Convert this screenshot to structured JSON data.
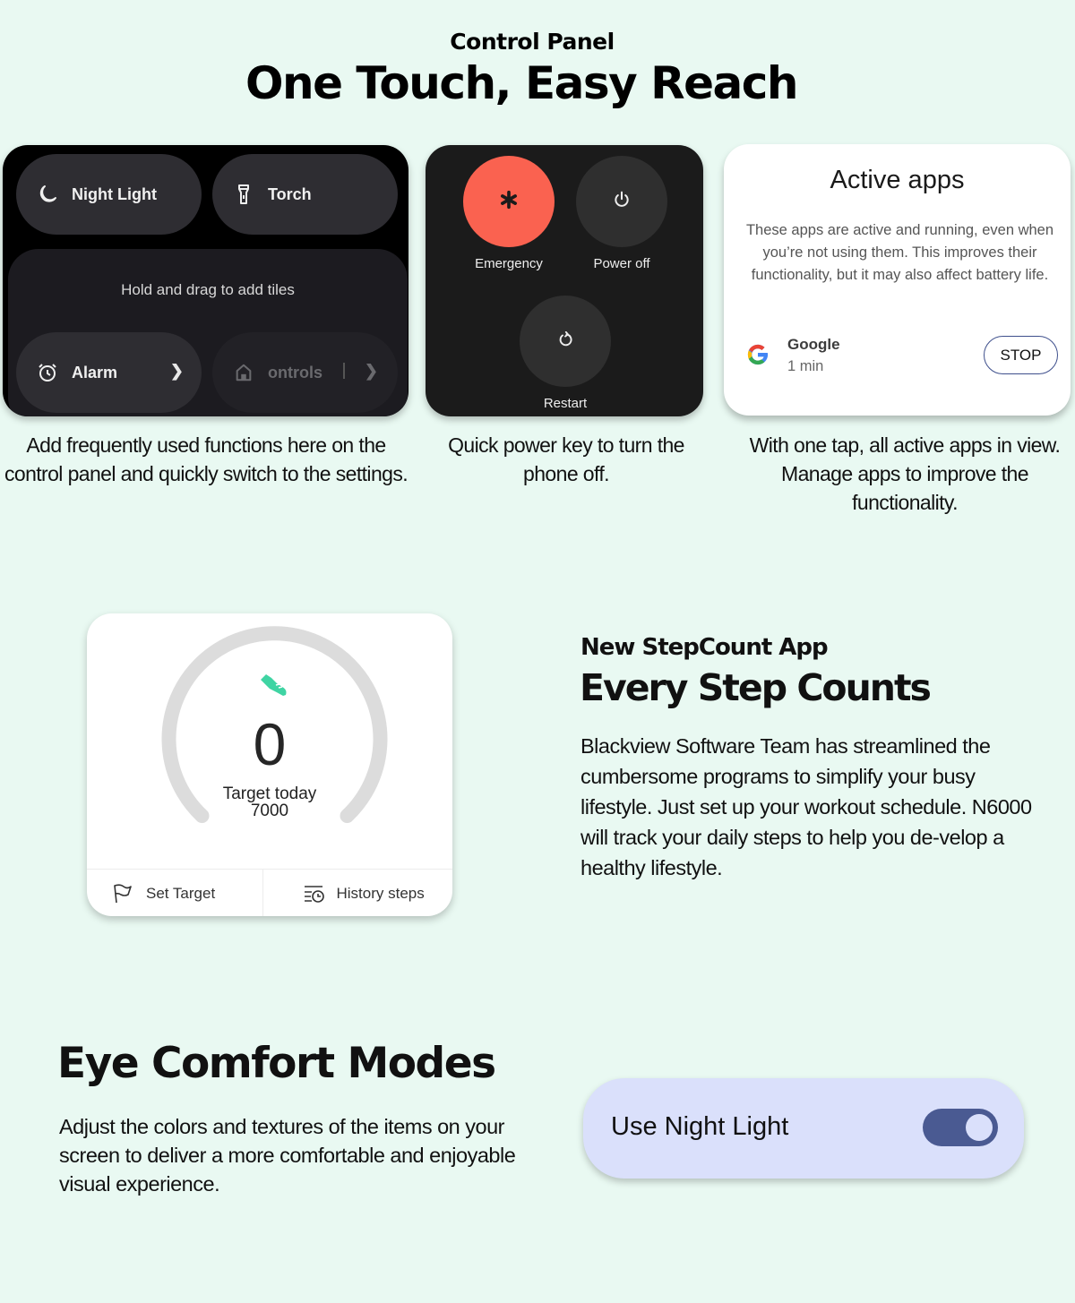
{
  "header": {
    "eyebrow": "Control Panel",
    "title": "One Touch, Easy Reach"
  },
  "quick_tiles": {
    "tiles": [
      {
        "label": "Night Light",
        "icon": "moon-icon"
      },
      {
        "label": "Torch",
        "icon": "flashlight-icon"
      },
      {
        "label": "Alarm",
        "icon": "alarm-clock-icon"
      },
      {
        "label": "ontrols",
        "icon": "home-icon"
      }
    ],
    "drop_hint": "Hold and drag to add tiles",
    "caption": "Add frequently used functions here on the control panel and quickly switch to the settings."
  },
  "power_menu": {
    "buttons": [
      {
        "label": "Emergency",
        "icon": "asterisk-icon",
        "color": "#fa6250"
      },
      {
        "label": "Power off",
        "icon": "power-icon"
      },
      {
        "label": "Restart",
        "icon": "restart-icon"
      }
    ],
    "caption": "Quick power key to turn the phone off."
  },
  "active_apps": {
    "title": "Active apps",
    "description": "These apps are active and running, even when you’re not using them. This improves their functionality, but it may also affect battery life.",
    "apps": [
      {
        "name": "Google",
        "duration": "1 min",
        "action": "STOP"
      }
    ],
    "caption": "With one tap, all active apps in view. Manage apps to improve the functionality."
  },
  "step_count": {
    "steps": "0",
    "target_label": "Target today",
    "target_value": "7000",
    "progress_fraction": 0,
    "accent_color": "#3fd4a3",
    "set_target_label": "Set Target",
    "history_label": "History steps",
    "eyebrow": "New StepCount App",
    "title": "Every Step Counts",
    "body": "Blackview Software Team has streamlined the cumbersome programs to simplify your busy lifestyle. Just set up your workout schedule. N6000 will track your daily steps to help you de-velop a healthy lifestyle."
  },
  "eye_comfort": {
    "title": "Eye Comfort Modes",
    "body": "Adjust the colors and textures of the items on your screen to deliver a more comfortable and enjoyable visual experience.",
    "setting_label": "Use Night Light",
    "toggle_on": true,
    "toggle_color": "#4a5a92"
  }
}
